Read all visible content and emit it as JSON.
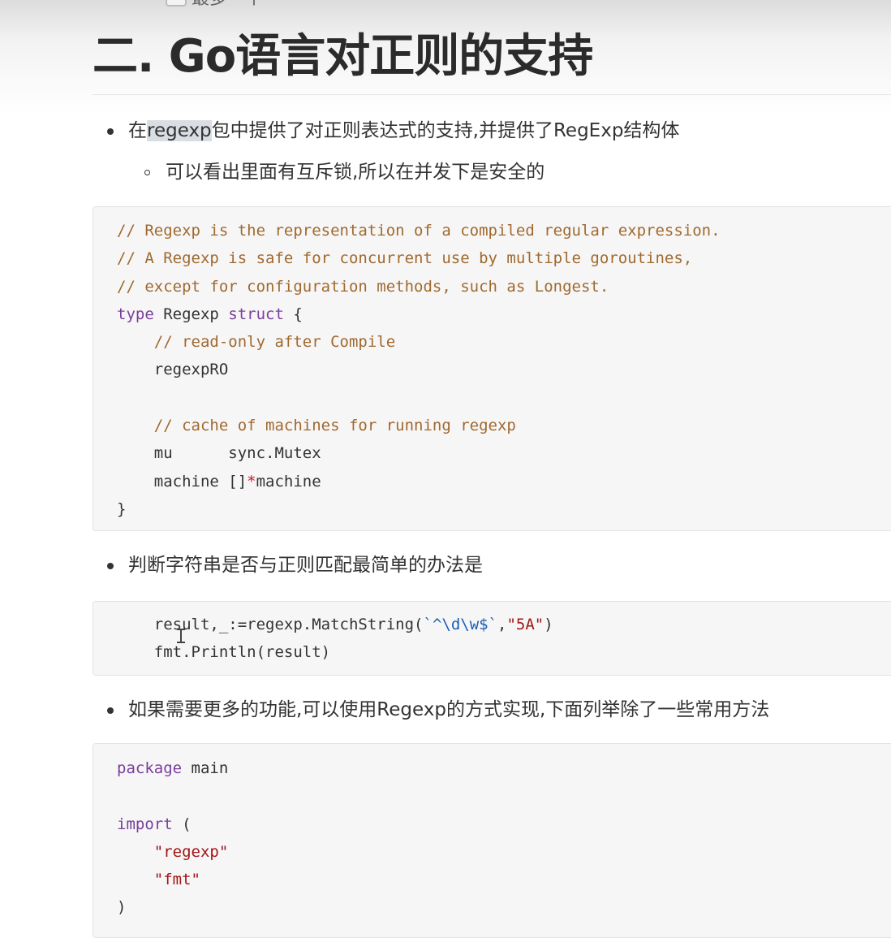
{
  "cut_line": {
    "text": "最多一个"
  },
  "heading": {
    "title": "二. Go语言对正则的支持"
  },
  "bullets": {
    "b1": {
      "prefix": "在",
      "highlight": "regexp",
      "suffix": "包中提供了对正则表达式的支持,并提供了RegExp结构体"
    },
    "b1_sub": "可以看出里面有互斥锁,所以在并发下是安全的",
    "b2": "判断字符串是否与正则匹配最简单的办法是",
    "b3": "如果需要更多的功能,可以使用Regexp的方式实现,下面列举除了一些常用方法"
  },
  "code1": {
    "comment1": "// Regexp is the representation of a compiled regular expression.",
    "comment2": "// A Regexp is safe for concurrent use by multiple goroutines,",
    "comment3": "// except for configuration methods, such as Longest.",
    "kw_type": "type",
    "type_name": " Regexp ",
    "kw_struct": "struct",
    "open_brace": " {",
    "comment4": "    // read-only after Compile",
    "field1": "    regexpRO",
    "comment5": "    // cache of machines for running regexp",
    "field2": "    mu      sync.Mutex",
    "field3a": "    machine []",
    "field3star": "*",
    "field3b": "machine",
    "close_brace": "}"
  },
  "code2": {
    "line1a": "    result,_:=regexp.MatchString(",
    "line1b": "`^\\d\\w$`",
    "line1c": ",",
    "line1d": "\"5A\"",
    "line1e": ")",
    "line2": "    fmt.Println(result)"
  },
  "code3": {
    "kw_package": "package",
    "pkg_name": " main",
    "kw_import": "import",
    "paren_open": " (",
    "imp1": "\"regexp\"",
    "imp2": "\"fmt\"",
    "paren_close": ")"
  }
}
